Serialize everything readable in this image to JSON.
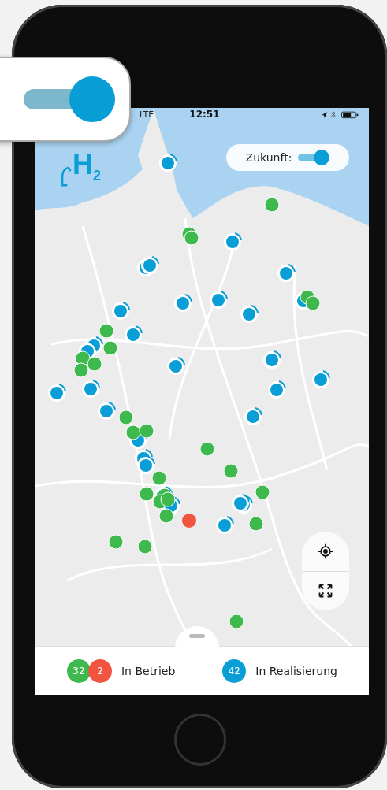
{
  "callout_toggle": {
    "on": true
  },
  "status_bar": {
    "network": "LTE",
    "time": "12:51"
  },
  "logo": {
    "text": "H$_{2}$"
  },
  "future_toggle": {
    "label": "Zukunft:",
    "on": true
  },
  "legend": [
    {
      "label": "In Betrieb",
      "badges": [
        {
          "count": "32",
          "color": "#3db94e"
        },
        {
          "count": "2",
          "color": "#f2553f"
        }
      ]
    },
    {
      "label": "In Realisierung",
      "badges": [
        {
          "count": "42",
          "color": "#0a9ed6"
        }
      ]
    }
  ]
}
